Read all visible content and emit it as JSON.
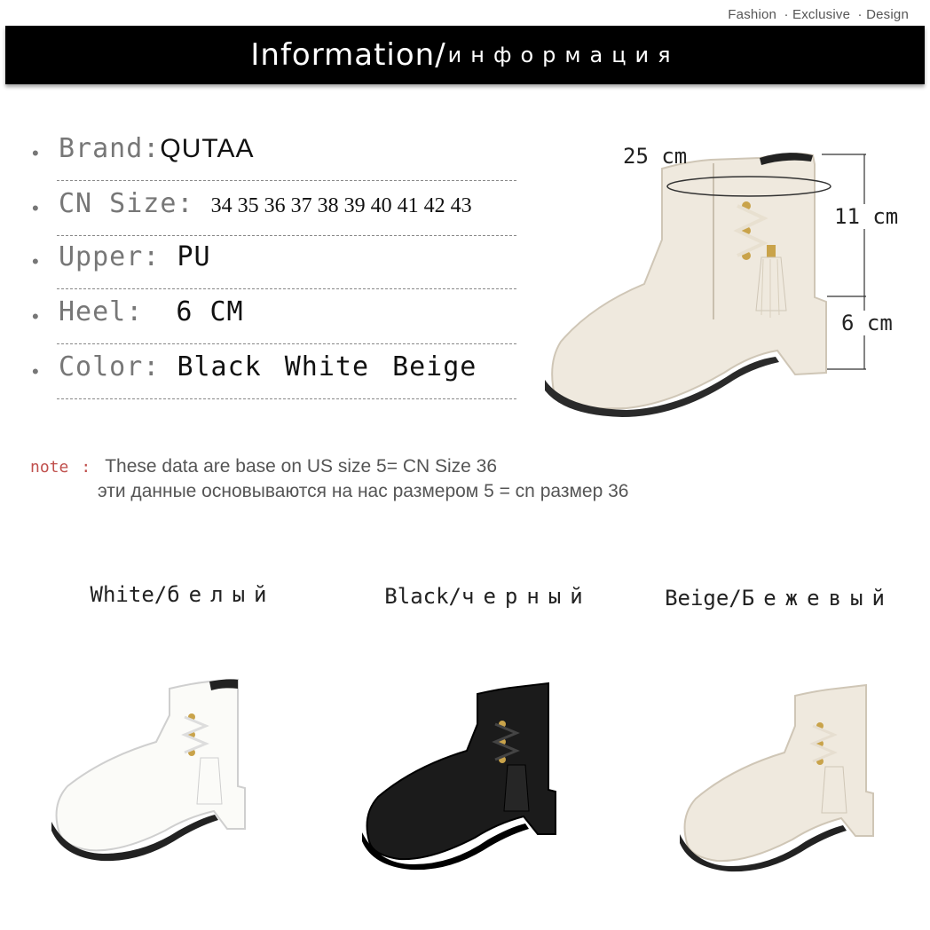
{
  "tagline": {
    "items": [
      "Fashion",
      "· Exclusive",
      "· Design"
    ]
  },
  "banner": {
    "title": "Information/",
    "subtitle": "информация"
  },
  "specs": {
    "brand": {
      "label": "Brand:",
      "value": "QUTAA"
    },
    "size": {
      "label": "CN Size:",
      "value": "34 35 36 37 38 39 40 41 42 43"
    },
    "upper": {
      "label": "Upper:",
      "value": "PU"
    },
    "heel": {
      "label": "Heel:",
      "value": "6 CM"
    },
    "color": {
      "label": "Color:",
      "values": [
        "Black",
        "White",
        "Beige"
      ]
    }
  },
  "measurements": {
    "circumference": "25 cm",
    "shaft": "11 cm",
    "heel": "6 cm"
  },
  "note": {
    "tag": "note",
    "colon": ":",
    "en": "These data are base on US size 5= CN Size 36",
    "ru": "эти данные основываются на нас размером 5 = cn размер 36"
  },
  "variants": [
    {
      "en": "White/",
      "ru": "белый",
      "color": "#fbfbf8"
    },
    {
      "en": "Black/",
      "ru": "черный",
      "color": "#1b1b1b"
    },
    {
      "en": "Beige/",
      "ru": "Бежевый",
      "color": "#efe9de"
    }
  ],
  "colors": {
    "banner": "#000000",
    "note_tag": "#c0504d",
    "beige_boot": "#efe9de"
  }
}
